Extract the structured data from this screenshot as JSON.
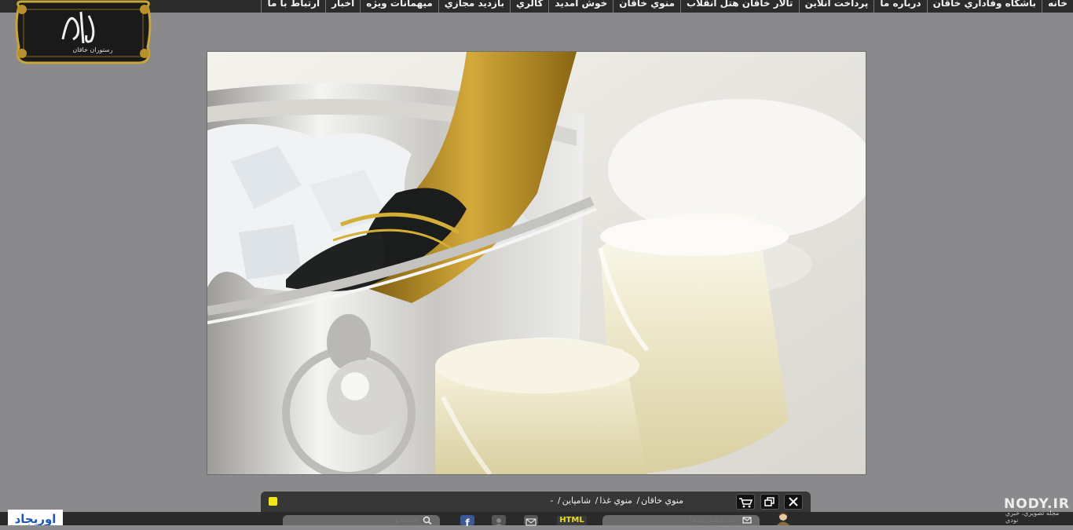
{
  "nav": {
    "items": [
      {
        "label": "خانه"
      },
      {
        "label": "باشگاه وفاداري خاقان"
      },
      {
        "label": "درباره ما"
      },
      {
        "label": "پرداخت آنلاین"
      },
      {
        "label": "تالار خاقان هتل انقلاب"
      },
      {
        "label": "منوي خاقان"
      },
      {
        "label": "خوش آمديد"
      },
      {
        "label": "گالري"
      },
      {
        "label": "بازديد مجازي"
      },
      {
        "label": "ميهمانات ويژه"
      },
      {
        "label": "اخبار"
      },
      {
        "label": "ارتباط با ما"
      }
    ]
  },
  "logo": {
    "text": "رستوران خاقان"
  },
  "viewer": {
    "breadcrumb": [
      "منوي خاقان",
      "منوي غذا",
      "شامپاين",
      "-"
    ],
    "close_icon": "close-icon",
    "restore_icon": "restore-window-icon",
    "cart_icon": "cart-icon",
    "status_color": "#f2e619"
  },
  "footer": {
    "search_placeholder": "جستجو",
    "email_placeholder": "ثبت ايميل شما",
    "html_label": "HTML",
    "watermark": "NODY.IR",
    "watermark_sub": "مجله تصويري، خبري نودي",
    "brand_logo_text": "اوریجاد"
  }
}
